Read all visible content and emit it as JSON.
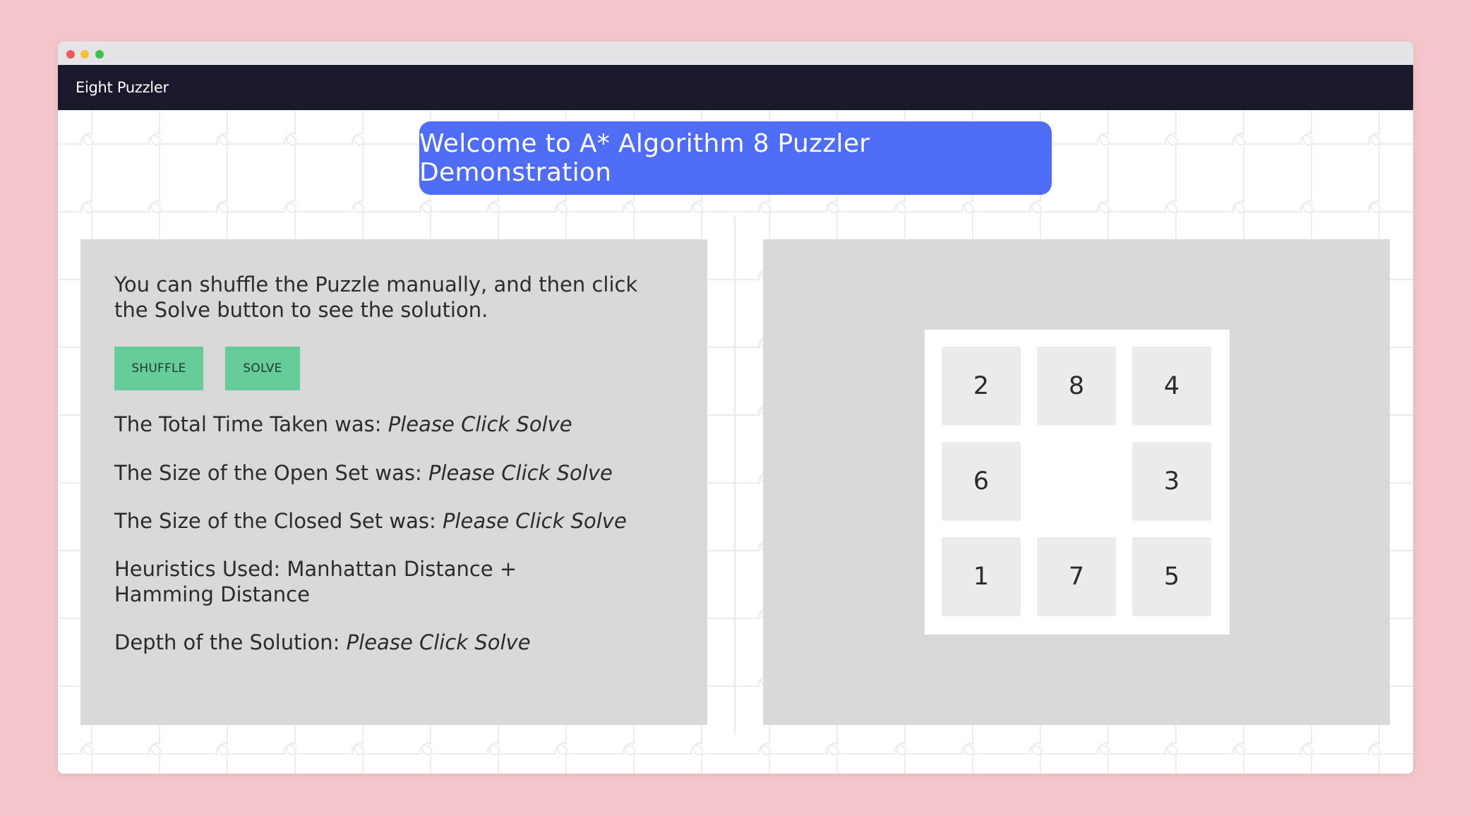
{
  "app": {
    "title": "Eight Puzzler"
  },
  "banner": {
    "text": "Welcome to A* Algorithm 8 Puzzler Demonstration"
  },
  "controls": {
    "intro": "You can shuffle the Puzzle manually, and then click the Solve button to see the solution.",
    "shuffle_label": "SHUFFLE",
    "solve_label": "SOLVE"
  },
  "stats": {
    "time_label": "The Total Time Taken was: ",
    "time_value": "Please Click Solve",
    "open_label": "The Size of the Open Set was: ",
    "open_value": "Please Click Solve",
    "closed_label": "The Size of the Closed Set was: ",
    "closed_value": "Please Click Solve",
    "heuristics": "Heuristics Used: Manhattan Distance + Hamming Distance",
    "depth_label": "Depth of the Solution: ",
    "depth_value": "Please Click Solve"
  },
  "puzzle": {
    "tiles": [
      "2",
      "8",
      "4",
      "6",
      "",
      "3",
      "1",
      "7",
      "5"
    ]
  },
  "colors": {
    "page_bg": "#f4c6c9",
    "navbar": "#181a2b",
    "banner": "#4f6cf7",
    "button": "#66cc99",
    "panel": "#d9d9d9",
    "tile": "#ececec"
  }
}
